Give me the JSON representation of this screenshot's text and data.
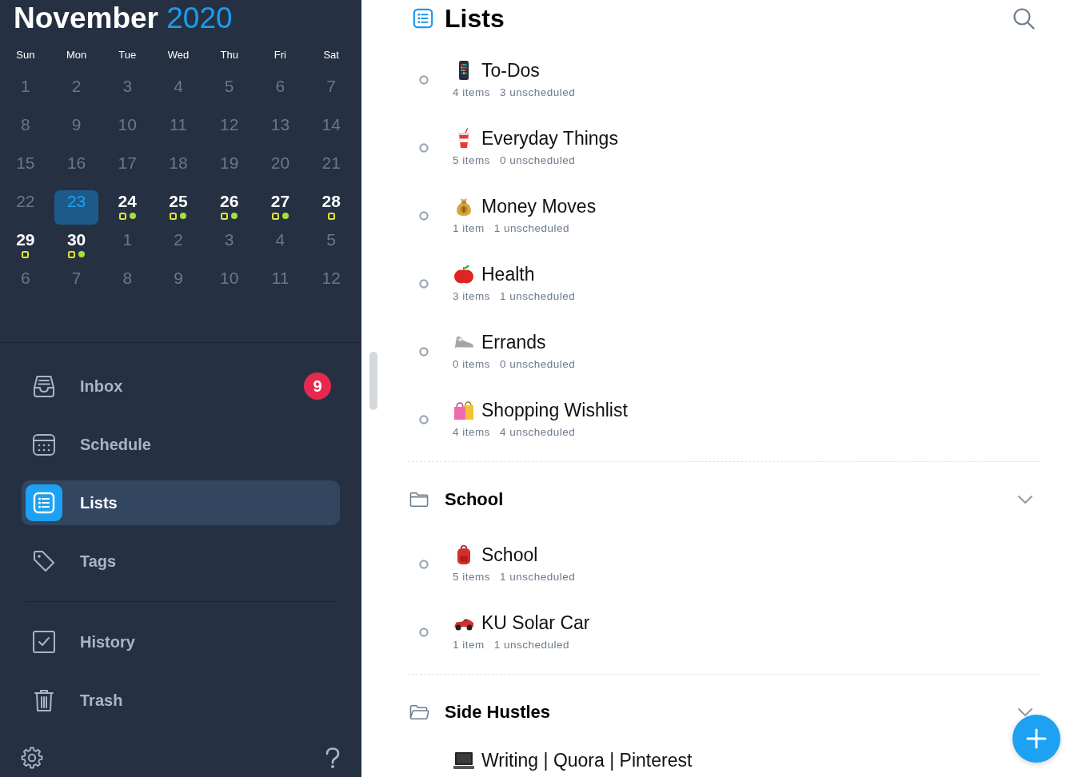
{
  "calendar": {
    "month": "November",
    "year": "2020",
    "weekdays": [
      "Sun",
      "Mon",
      "Tue",
      "Wed",
      "Thu",
      "Fri",
      "Sat"
    ],
    "weeks": [
      [
        {
          "label": "1",
          "dimmed": true,
          "selected": false
        },
        {
          "label": "2",
          "dimmed": true,
          "selected": false
        },
        {
          "label": "3",
          "dimmed": true,
          "selected": false
        },
        {
          "label": "4",
          "dimmed": true,
          "selected": false
        },
        {
          "label": "5",
          "dimmed": true,
          "selected": false
        },
        {
          "label": "6",
          "dimmed": true,
          "selected": false
        },
        {
          "label": "7",
          "dimmed": true,
          "selected": false
        }
      ],
      [
        {
          "label": "8",
          "dimmed": true,
          "selected": false
        },
        {
          "label": "9",
          "dimmed": true,
          "selected": false
        },
        {
          "label": "10",
          "dimmed": true,
          "selected": false
        },
        {
          "label": "11",
          "dimmed": true,
          "selected": false
        },
        {
          "label": "12",
          "dimmed": true,
          "selected": false
        },
        {
          "label": "13",
          "dimmed": true,
          "selected": false
        },
        {
          "label": "14",
          "dimmed": true,
          "selected": false
        }
      ],
      [
        {
          "label": "15",
          "dimmed": true,
          "selected": false
        },
        {
          "label": "16",
          "dimmed": true,
          "selected": false
        },
        {
          "label": "17",
          "dimmed": true,
          "selected": false
        },
        {
          "label": "18",
          "dimmed": true,
          "selected": false
        },
        {
          "label": "19",
          "dimmed": true,
          "selected": false
        },
        {
          "label": "20",
          "dimmed": true,
          "selected": false
        },
        {
          "label": "21",
          "dimmed": true,
          "selected": false
        }
      ],
      [
        {
          "label": "22",
          "dimmed": true,
          "selected": false
        },
        {
          "label": "23",
          "selected": true
        },
        {
          "label": "24",
          "dimmed": false,
          "selected": false,
          "markers": [
            {
              "kind": "square",
              "color": "#e5e23b"
            },
            {
              "kind": "dot",
              "color": "#a3e03b"
            }
          ]
        },
        {
          "label": "25",
          "dimmed": false,
          "selected": false,
          "markers": [
            {
              "kind": "square",
              "color": "#e5e23b"
            },
            {
              "kind": "dot",
              "color": "#a3e03b"
            }
          ]
        },
        {
          "label": "26",
          "dimmed": false,
          "selected": false,
          "markers": [
            {
              "kind": "square",
              "color": "#e5e23b"
            },
            {
              "kind": "dot",
              "color": "#a3e03b"
            }
          ]
        },
        {
          "label": "27",
          "dimmed": false,
          "selected": false,
          "markers": [
            {
              "kind": "square",
              "color": "#e5e23b"
            },
            {
              "kind": "dot",
              "color": "#a3e03b"
            }
          ]
        },
        {
          "label": "28",
          "dimmed": false,
          "selected": false,
          "markers": [
            {
              "kind": "square",
              "color": "#e5e23b"
            }
          ]
        }
      ],
      [
        {
          "label": "29",
          "dimmed": false,
          "selected": false,
          "markers": [
            {
              "kind": "square",
              "color": "#e5e23b"
            }
          ]
        },
        {
          "label": "30",
          "dimmed": false,
          "selected": false,
          "markers": [
            {
              "kind": "square",
              "color": "#e5e23b"
            },
            {
              "kind": "dot",
              "color": "#a3e03b"
            }
          ]
        },
        {
          "label": "1",
          "dimmed": true,
          "selected": false
        },
        {
          "label": "2",
          "dimmed": true,
          "selected": false
        },
        {
          "label": "3",
          "dimmed": true,
          "selected": false
        },
        {
          "label": "4",
          "dimmed": true,
          "selected": false
        },
        {
          "label": "5",
          "dimmed": true,
          "selected": false
        }
      ],
      [
        {
          "label": "6",
          "dimmed": true,
          "selected": false
        },
        {
          "label": "7",
          "dimmed": true,
          "selected": false
        },
        {
          "label": "8",
          "dimmed": true,
          "selected": false
        },
        {
          "label": "9",
          "dimmed": true,
          "selected": false
        },
        {
          "label": "10",
          "dimmed": true,
          "selected": false
        },
        {
          "label": "11",
          "dimmed": true,
          "selected": false
        },
        {
          "label": "12",
          "dimmed": true,
          "selected": false
        }
      ]
    ]
  },
  "nav": {
    "groups": [
      [
        {
          "label": "Inbox",
          "badge": "9",
          "selected": false
        },
        {
          "label": "Schedule",
          "selected": false
        },
        {
          "label": "Lists",
          "selected": true
        },
        {
          "label": "Tags",
          "selected": false
        }
      ],
      [
        {
          "label": "History",
          "selected": false
        },
        {
          "label": "Trash",
          "selected": false
        }
      ]
    ]
  },
  "lists": {
    "title": "Lists",
    "items": [
      {
        "title": "To-Dos",
        "count": "4 items",
        "unscheduled": "3 unscheduled"
      },
      {
        "title": "Everyday Things",
        "count": "5 items",
        "unscheduled": "0 unscheduled"
      },
      {
        "title": "Money Moves",
        "count": "1 item",
        "unscheduled": "1 unscheduled"
      },
      {
        "title": "Health",
        "count": "3 items",
        "unscheduled": "1 unscheduled"
      },
      {
        "title": "Errands",
        "count": "0 items",
        "unscheduled": "0 unscheduled"
      },
      {
        "title": "Shopping Wishlist",
        "count": "4 items",
        "unscheduled": "4 unscheduled"
      }
    ],
    "folders": [
      {
        "name": "School",
        "expanded": true,
        "items": [
          {
            "title": "School",
            "count": "5 items",
            "unscheduled": "1 unscheduled"
          },
          {
            "title": "KU Solar Car",
            "count": "1 item",
            "unscheduled": "1 unscheduled"
          }
        ]
      },
      {
        "name": "Side Hustles",
        "expanded": true,
        "items": [
          {
            "title": "Writing | Quora | Pinterest"
          }
        ]
      }
    ]
  }
}
